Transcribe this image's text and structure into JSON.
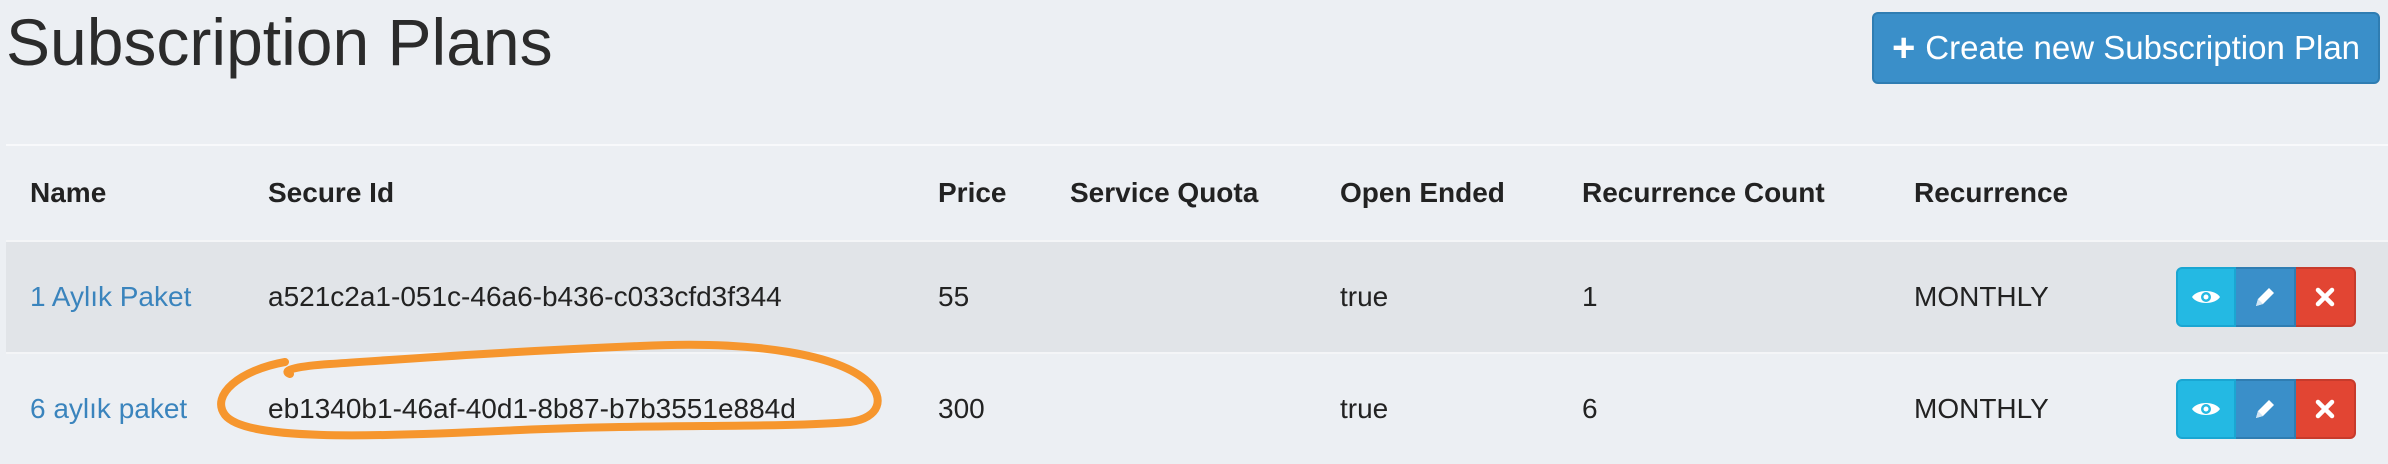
{
  "header": {
    "title": "Subscription Plans",
    "create_button": {
      "icon": "plus-icon",
      "label": "Create new Subscription Plan"
    }
  },
  "table": {
    "columns": [
      "Name",
      "Secure Id",
      "Price",
      "Service Quota",
      "Open Ended",
      "Recurrence Count",
      "Recurrence"
    ],
    "rows": [
      {
        "name": "1 Aylık Paket",
        "secure_id": "a521c2a1-051c-46a6-b436-c033cfd3f344",
        "price": "55",
        "service_quota": "",
        "open_ended": "true",
        "recurrence_count": "1",
        "recurrence": "MONTHLY"
      },
      {
        "name": "6 aylık paket",
        "secure_id": "eb1340b1-46af-40d1-8b87-b7b3551e884d",
        "price": "300",
        "service_quota": "",
        "open_ended": "true",
        "recurrence_count": "6",
        "recurrence": "MONTHLY"
      }
    ],
    "row_actions": [
      "eye-icon",
      "pencil-icon",
      "close-icon"
    ]
  },
  "colors": {
    "primary": "#3a8fc9",
    "info": "#24b9e3",
    "danger": "#e24533",
    "link": "#3a84bd",
    "annotation": "#f6962e"
  },
  "annotation": {
    "shape": "hand-drawn-ellipse",
    "target": "table.rows.1.secure_id"
  }
}
